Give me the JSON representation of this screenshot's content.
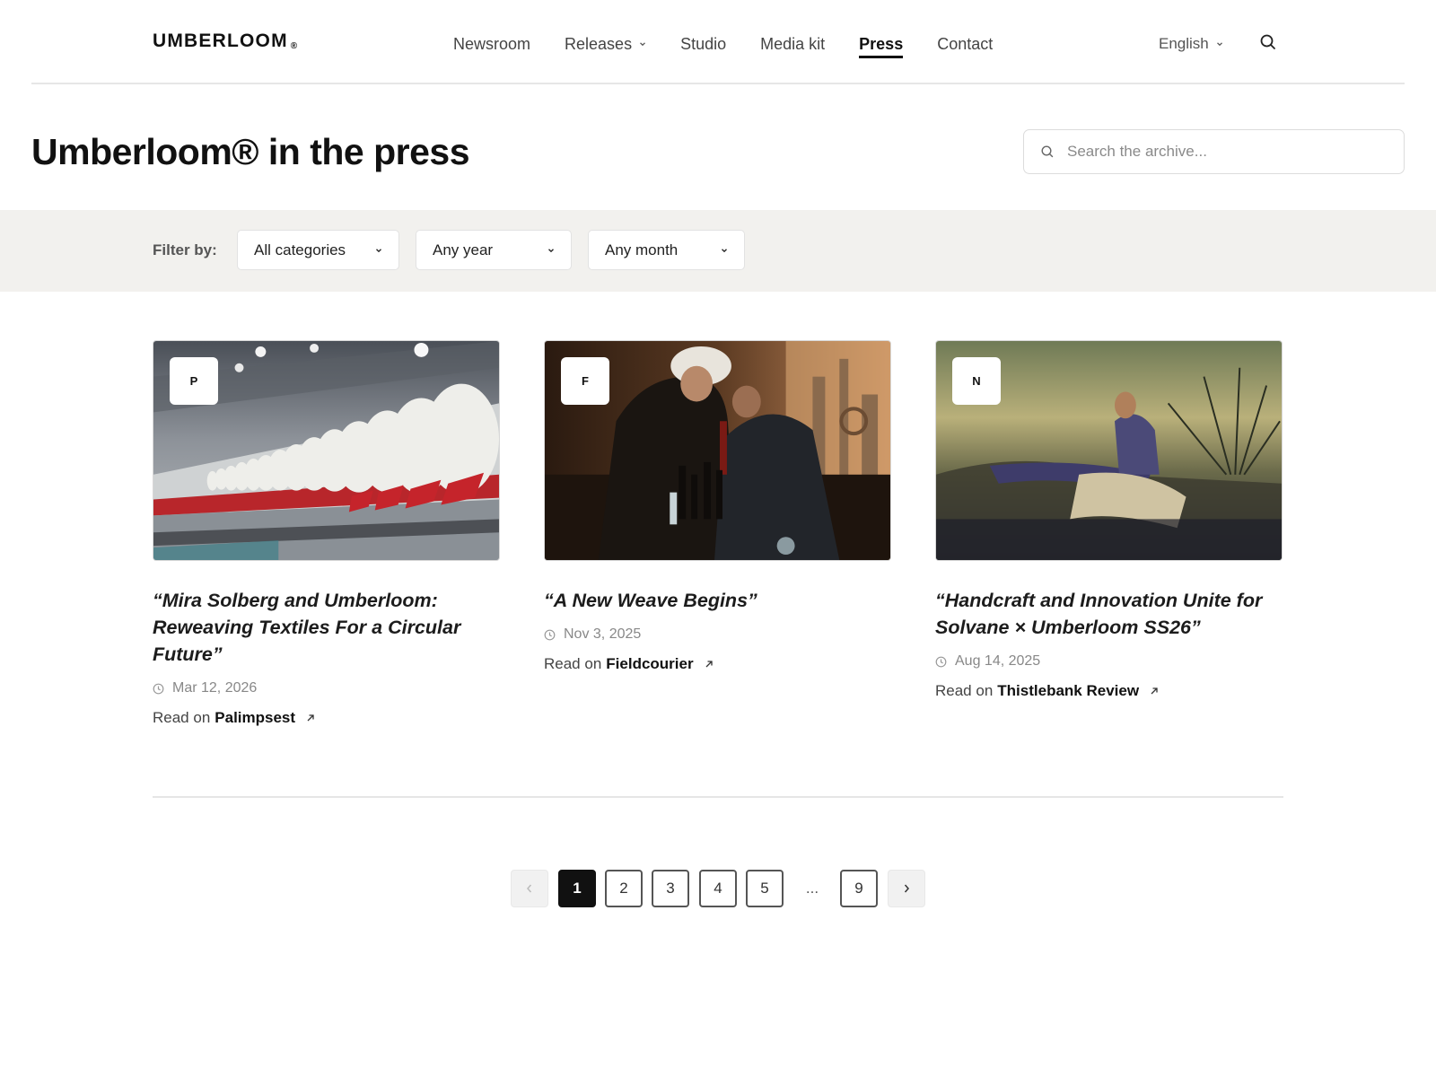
{
  "header": {
    "logo": "UMBERLOOM",
    "logo_mark": "®",
    "nav": [
      {
        "label": "Newsroom",
        "dropdown": false,
        "active": false
      },
      {
        "label": "Releases",
        "dropdown": true,
        "active": false
      },
      {
        "label": "Studio",
        "dropdown": false,
        "active": false
      },
      {
        "label": "Media kit",
        "dropdown": false,
        "active": false
      },
      {
        "label": "Press",
        "dropdown": false,
        "active": true
      },
      {
        "label": "Contact",
        "dropdown": false,
        "active": false
      }
    ],
    "language": "English",
    "search_icon": "search-icon"
  },
  "page": {
    "title": "Umberloom® in the press",
    "search_placeholder": "Search the archive..."
  },
  "filters": {
    "label": "Filter by:",
    "category": "All categories",
    "year": "Any year",
    "month": "Any month"
  },
  "articles": [
    {
      "badge": "P",
      "title": "“Mira Solberg and Umberloom: Reweaving Textiles For a Circular Future”",
      "date": "Mar 12, 2026",
      "read_prefix": "Read on",
      "source": "Palimpsest"
    },
    {
      "badge": "F",
      "title": "“A New Weave Begins”",
      "date": "Nov 3, 2025",
      "read_prefix": "Read on",
      "source": "Fieldcourier"
    },
    {
      "badge": "N",
      "title": "“Handcraft and Innovation Unite for Solvane × Umberloom SS26”",
      "date": "Aug 14, 2025",
      "read_prefix": "Read on",
      "source": "Thistlebank Review"
    }
  ],
  "pagination": {
    "pages": [
      "1",
      "2",
      "3",
      "4",
      "5"
    ],
    "ellipsis": "...",
    "last": "9",
    "current": "1"
  },
  "colors": {
    "text": "#111111",
    "filter_bg": "#f2f1ee",
    "accent": "#111111"
  }
}
